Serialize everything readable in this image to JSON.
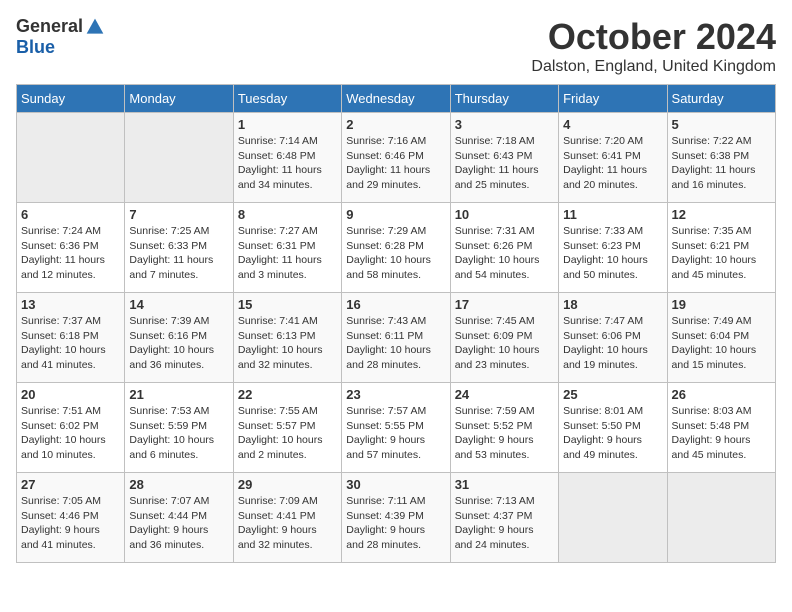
{
  "header": {
    "logo_general": "General",
    "logo_blue": "Blue",
    "month": "October 2024",
    "location": "Dalston, England, United Kingdom"
  },
  "days_of_week": [
    "Sunday",
    "Monday",
    "Tuesday",
    "Wednesday",
    "Thursday",
    "Friday",
    "Saturday"
  ],
  "weeks": [
    [
      {
        "day": "",
        "info": ""
      },
      {
        "day": "",
        "info": ""
      },
      {
        "day": "1",
        "info": "Sunrise: 7:14 AM\nSunset: 6:48 PM\nDaylight: 11 hours\nand 34 minutes."
      },
      {
        "day": "2",
        "info": "Sunrise: 7:16 AM\nSunset: 6:46 PM\nDaylight: 11 hours\nand 29 minutes."
      },
      {
        "day": "3",
        "info": "Sunrise: 7:18 AM\nSunset: 6:43 PM\nDaylight: 11 hours\nand 25 minutes."
      },
      {
        "day": "4",
        "info": "Sunrise: 7:20 AM\nSunset: 6:41 PM\nDaylight: 11 hours\nand 20 minutes."
      },
      {
        "day": "5",
        "info": "Sunrise: 7:22 AM\nSunset: 6:38 PM\nDaylight: 11 hours\nand 16 minutes."
      }
    ],
    [
      {
        "day": "6",
        "info": "Sunrise: 7:24 AM\nSunset: 6:36 PM\nDaylight: 11 hours\nand 12 minutes."
      },
      {
        "day": "7",
        "info": "Sunrise: 7:25 AM\nSunset: 6:33 PM\nDaylight: 11 hours\nand 7 minutes."
      },
      {
        "day": "8",
        "info": "Sunrise: 7:27 AM\nSunset: 6:31 PM\nDaylight: 11 hours\nand 3 minutes."
      },
      {
        "day": "9",
        "info": "Sunrise: 7:29 AM\nSunset: 6:28 PM\nDaylight: 10 hours\nand 58 minutes."
      },
      {
        "day": "10",
        "info": "Sunrise: 7:31 AM\nSunset: 6:26 PM\nDaylight: 10 hours\nand 54 minutes."
      },
      {
        "day": "11",
        "info": "Sunrise: 7:33 AM\nSunset: 6:23 PM\nDaylight: 10 hours\nand 50 minutes."
      },
      {
        "day": "12",
        "info": "Sunrise: 7:35 AM\nSunset: 6:21 PM\nDaylight: 10 hours\nand 45 minutes."
      }
    ],
    [
      {
        "day": "13",
        "info": "Sunrise: 7:37 AM\nSunset: 6:18 PM\nDaylight: 10 hours\nand 41 minutes."
      },
      {
        "day": "14",
        "info": "Sunrise: 7:39 AM\nSunset: 6:16 PM\nDaylight: 10 hours\nand 36 minutes."
      },
      {
        "day": "15",
        "info": "Sunrise: 7:41 AM\nSunset: 6:13 PM\nDaylight: 10 hours\nand 32 minutes."
      },
      {
        "day": "16",
        "info": "Sunrise: 7:43 AM\nSunset: 6:11 PM\nDaylight: 10 hours\nand 28 minutes."
      },
      {
        "day": "17",
        "info": "Sunrise: 7:45 AM\nSunset: 6:09 PM\nDaylight: 10 hours\nand 23 minutes."
      },
      {
        "day": "18",
        "info": "Sunrise: 7:47 AM\nSunset: 6:06 PM\nDaylight: 10 hours\nand 19 minutes."
      },
      {
        "day": "19",
        "info": "Sunrise: 7:49 AM\nSunset: 6:04 PM\nDaylight: 10 hours\nand 15 minutes."
      }
    ],
    [
      {
        "day": "20",
        "info": "Sunrise: 7:51 AM\nSunset: 6:02 PM\nDaylight: 10 hours\nand 10 minutes."
      },
      {
        "day": "21",
        "info": "Sunrise: 7:53 AM\nSunset: 5:59 PM\nDaylight: 10 hours\nand 6 minutes."
      },
      {
        "day": "22",
        "info": "Sunrise: 7:55 AM\nSunset: 5:57 PM\nDaylight: 10 hours\nand 2 minutes."
      },
      {
        "day": "23",
        "info": "Sunrise: 7:57 AM\nSunset: 5:55 PM\nDaylight: 9 hours\nand 57 minutes."
      },
      {
        "day": "24",
        "info": "Sunrise: 7:59 AM\nSunset: 5:52 PM\nDaylight: 9 hours\nand 53 minutes."
      },
      {
        "day": "25",
        "info": "Sunrise: 8:01 AM\nSunset: 5:50 PM\nDaylight: 9 hours\nand 49 minutes."
      },
      {
        "day": "26",
        "info": "Sunrise: 8:03 AM\nSunset: 5:48 PM\nDaylight: 9 hours\nand 45 minutes."
      }
    ],
    [
      {
        "day": "27",
        "info": "Sunrise: 7:05 AM\nSunset: 4:46 PM\nDaylight: 9 hours\nand 41 minutes."
      },
      {
        "day": "28",
        "info": "Sunrise: 7:07 AM\nSunset: 4:44 PM\nDaylight: 9 hours\nand 36 minutes."
      },
      {
        "day": "29",
        "info": "Sunrise: 7:09 AM\nSunset: 4:41 PM\nDaylight: 9 hours\nand 32 minutes."
      },
      {
        "day": "30",
        "info": "Sunrise: 7:11 AM\nSunset: 4:39 PM\nDaylight: 9 hours\nand 28 minutes."
      },
      {
        "day": "31",
        "info": "Sunrise: 7:13 AM\nSunset: 4:37 PM\nDaylight: 9 hours\nand 24 minutes."
      },
      {
        "day": "",
        "info": ""
      },
      {
        "day": "",
        "info": ""
      }
    ]
  ]
}
